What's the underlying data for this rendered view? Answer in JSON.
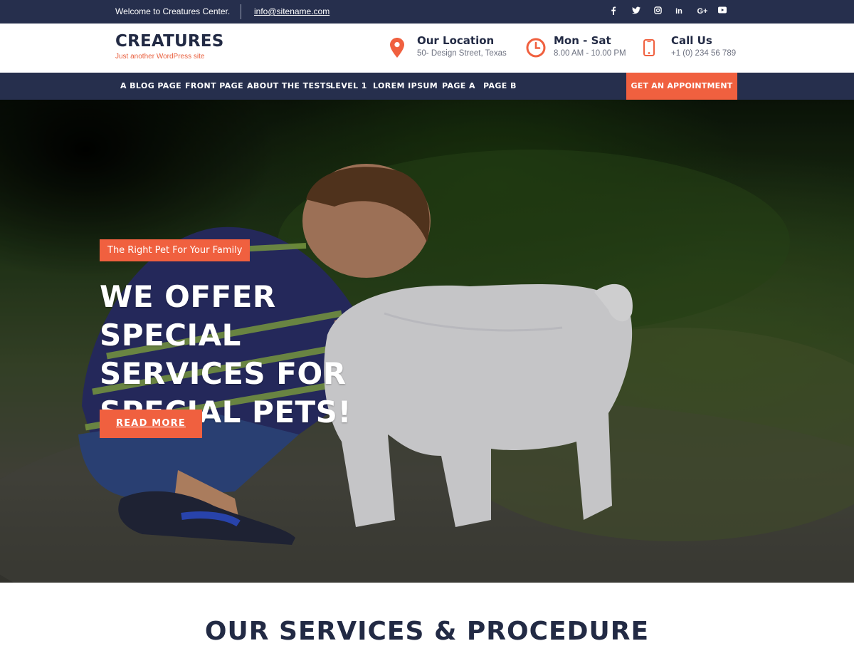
{
  "topbar": {
    "welcome": "Welcome to Creatures Center.",
    "email": "info@sitename.com",
    "social": [
      "facebook-icon",
      "twitter-icon",
      "instagram-icon",
      "linkedin-icon",
      "google-plus-icon",
      "youtube-icon"
    ],
    "linkedin_text": "in",
    "googleplus_text": "G+"
  },
  "header": {
    "site_title": "CREATURES",
    "tagline": "Just another WordPress site",
    "location_title": "Our Location",
    "location_sub": "50- Design Street, Texas",
    "hours_title": "Mon - Sat",
    "hours_sub": "8.00 AM - 10.00 PM",
    "call_title": "Call Us",
    "call_sub": "+1 (0) 234 56 789"
  },
  "nav": {
    "items": [
      "A BLOG PAGE",
      "FRONT PAGE",
      "ABOUT THE TESTS",
      "LEVEL 1",
      "LOREM IPSUM",
      "PAGE A",
      "PAGE B"
    ],
    "cta": "GET AN APPOINTMENT"
  },
  "hero": {
    "badge": "The Right Pet For Your Family",
    "title_line1": "WE OFFER SPECIAL",
    "title_line2": "SERVICES FOR",
    "title_line3": "SPECIAL PETS!",
    "button": "READ MORE"
  },
  "services": {
    "title": "OUR SERVICES & PROCEDURE"
  },
  "colors": {
    "navy": "#262f4d",
    "accent": "#f0603f",
    "heading": "#222a44"
  }
}
